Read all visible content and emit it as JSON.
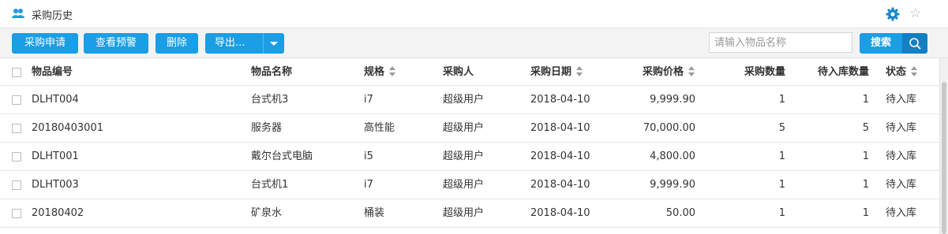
{
  "header": {
    "title": "采购历史",
    "icon": "users-icon",
    "settings_icon": "gear-icon",
    "favorite_icon": "star-icon",
    "star_glyph": "☆"
  },
  "toolbar": {
    "apply_label": "采购申请",
    "warning_label": "查看预警",
    "delete_label": "删除",
    "export_label": "导出...",
    "search_placeholder": "请输入物品名称",
    "search_label": "搜索"
  },
  "colors": {
    "accent": "#1a9ee6",
    "accent_dark": "#1281c3"
  },
  "table": {
    "columns": [
      {
        "key": "code",
        "label": "物品编号",
        "sortable": false
      },
      {
        "key": "name",
        "label": "物品名称",
        "sortable": false
      },
      {
        "key": "spec",
        "label": "规格",
        "sortable": true
      },
      {
        "key": "buyer",
        "label": "采购人",
        "sortable": false
      },
      {
        "key": "date",
        "label": "采购日期",
        "sortable": true
      },
      {
        "key": "price",
        "label": "采购价格",
        "sortable": true
      },
      {
        "key": "qty",
        "label": "采购数量",
        "sortable": false
      },
      {
        "key": "pending",
        "label": "待入库数量",
        "sortable": false
      },
      {
        "key": "status",
        "label": "状态",
        "sortable": true
      }
    ],
    "rows": [
      {
        "code": "DLHT004",
        "name": "台式机3",
        "spec": "i7",
        "buyer": "超级用户",
        "date": "2018-04-10",
        "price": "9,999.90",
        "qty": "1",
        "pending": "1",
        "status": "待入库"
      },
      {
        "code": "20180403001",
        "name": "服务器",
        "spec": "高性能",
        "buyer": "超级用户",
        "date": "2018-04-10",
        "price": "70,000.00",
        "qty": "5",
        "pending": "5",
        "status": "待入库"
      },
      {
        "code": "DLHT001",
        "name": "戴尔台式电脑",
        "spec": "i5",
        "buyer": "超级用户",
        "date": "2018-04-10",
        "price": "4,800.00",
        "qty": "1",
        "pending": "1",
        "status": "待入库"
      },
      {
        "code": "DLHT003",
        "name": "台式机1",
        "spec": "i7",
        "buyer": "超级用户",
        "date": "2018-04-10",
        "price": "9,999.90",
        "qty": "1",
        "pending": "1",
        "status": "待入库"
      },
      {
        "code": "20180402",
        "name": "矿泉水",
        "spec": "桶装",
        "buyer": "超级用户",
        "date": "2018-04-10",
        "price": "50.00",
        "qty": "1",
        "pending": "1",
        "status": "待入库"
      }
    ]
  }
}
